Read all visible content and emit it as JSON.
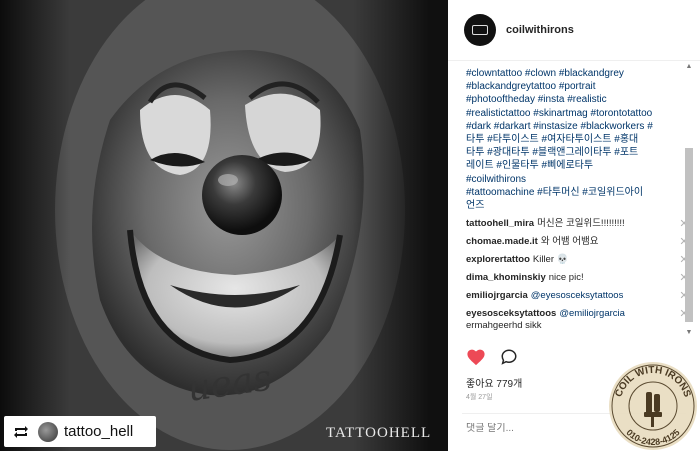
{
  "post": {
    "username": "coilwithirons",
    "caption_lines": [
      "#clowntattoo #clown #blackandgrey",
      "#blackandgreytattoo #portrait",
      "#photooftheday #insta #realistic",
      "#realistictattoo #skinartmag #torontotattoo",
      "#dark #darkart #instasize #blackworkers #",
      "타투 #타투이스트 #여자타투이스트 #홍대",
      "타투 #광대타투 #블랙앤그레이타투 #포트",
      "레이트 #인물타투 #삐에로타투",
      "#coilwithirons",
      "#tattoomachine #타투머신 #코일위드아이",
      "언즈"
    ],
    "likes": "좋아요 779개",
    "date": "4월 27일",
    "add_comment_placeholder": "댓글 달기..."
  },
  "comments": [
    {
      "author": "tattoohell_mira",
      "text": "머신은 코일위드!!!!!!!!!",
      "mention": ""
    },
    {
      "author": "chomae.made.it",
      "text": "와 어뱀 어뱀요",
      "mention": ""
    },
    {
      "author": "explorertattoo",
      "text": "Killer 💀",
      "mention": ""
    },
    {
      "author": "dima_khominskiy",
      "text": "nice pic!",
      "mention": ""
    },
    {
      "author": "emiliojrgarcia",
      "text": "",
      "mention": "@eyesosceksytattoos"
    },
    {
      "author": "eyesosceksytattoos",
      "text": "",
      "mention": "@emiliojrgarcia",
      "text2": "ermahgeerhd sikk"
    }
  ],
  "photo": {
    "repost_handle": "tattoo_hell",
    "watermark": "TATTOOHELL",
    "skin_script": "ueas"
  },
  "stamp": {
    "top_text": "COIL WITH IRONS",
    "bottom_text": "010-2428-4125"
  },
  "icons": {
    "like": "heart-icon",
    "comment": "comment-bubble-icon",
    "repost": "repost-icon",
    "remove": "close-icon"
  },
  "colors": {
    "like": "#ed4956",
    "hashtag": "#003569",
    "stamp": "#e8dcc0"
  }
}
